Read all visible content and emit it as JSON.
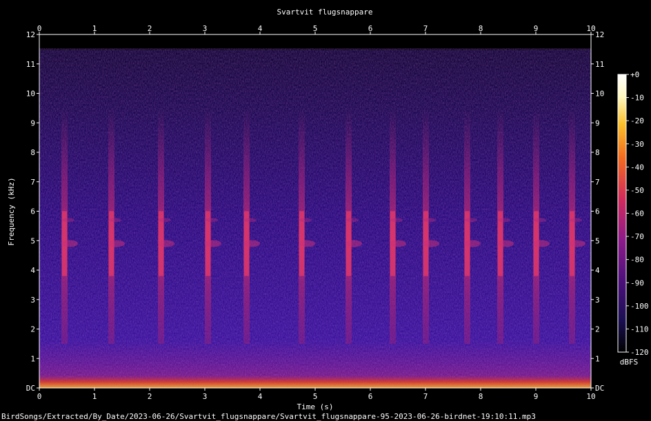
{
  "chart_data": {
    "type": "heatmap",
    "title": "Svartvit flugsnappare",
    "xlabel": "Time (s)",
    "ylabel": "Frequency (kHz)",
    "x_ticks": [
      "0",
      "1",
      "2",
      "3",
      "4",
      "5",
      "6",
      "7",
      "8",
      "9",
      "10"
    ],
    "y_ticks": [
      "DC",
      "1",
      "2",
      "3",
      "4",
      "5",
      "6",
      "7",
      "8",
      "9",
      "10",
      "11",
      "12"
    ],
    "xlim": [
      0,
      10
    ],
    "ylim": [
      0,
      12
    ],
    "colorbar": {
      "label": "dBFS",
      "ticks": [
        "+0",
        "-10",
        "-20",
        "-30",
        "-40",
        "-50",
        "-60",
        "-70",
        "-80",
        "-90",
        "-100",
        "-110",
        "-120"
      ],
      "range": [
        -120,
        0
      ],
      "colors": [
        "#000000",
        "#1c0f55",
        "#4a0f7a",
        "#8b1a8a",
        "#d02a5c",
        "#f26b1f",
        "#fbc02a",
        "#fff8c0",
        "#ffffff"
      ]
    },
    "background_db": -100,
    "noise_ceiling_khz": 11.5,
    "calls_s": [
      0.45,
      1.3,
      2.2,
      3.05,
      3.75,
      4.75,
      5.6,
      6.4,
      7.0,
      7.75,
      8.35,
      9.0,
      9.65
    ]
  },
  "footer": {
    "filename": "BirdSongs/Extracted/By_Date/2023-06-26/Svartvit_flugsnappare/Svartvit_flugsnappare-95-2023-06-26-birdnet-19:10:11.mp3"
  }
}
